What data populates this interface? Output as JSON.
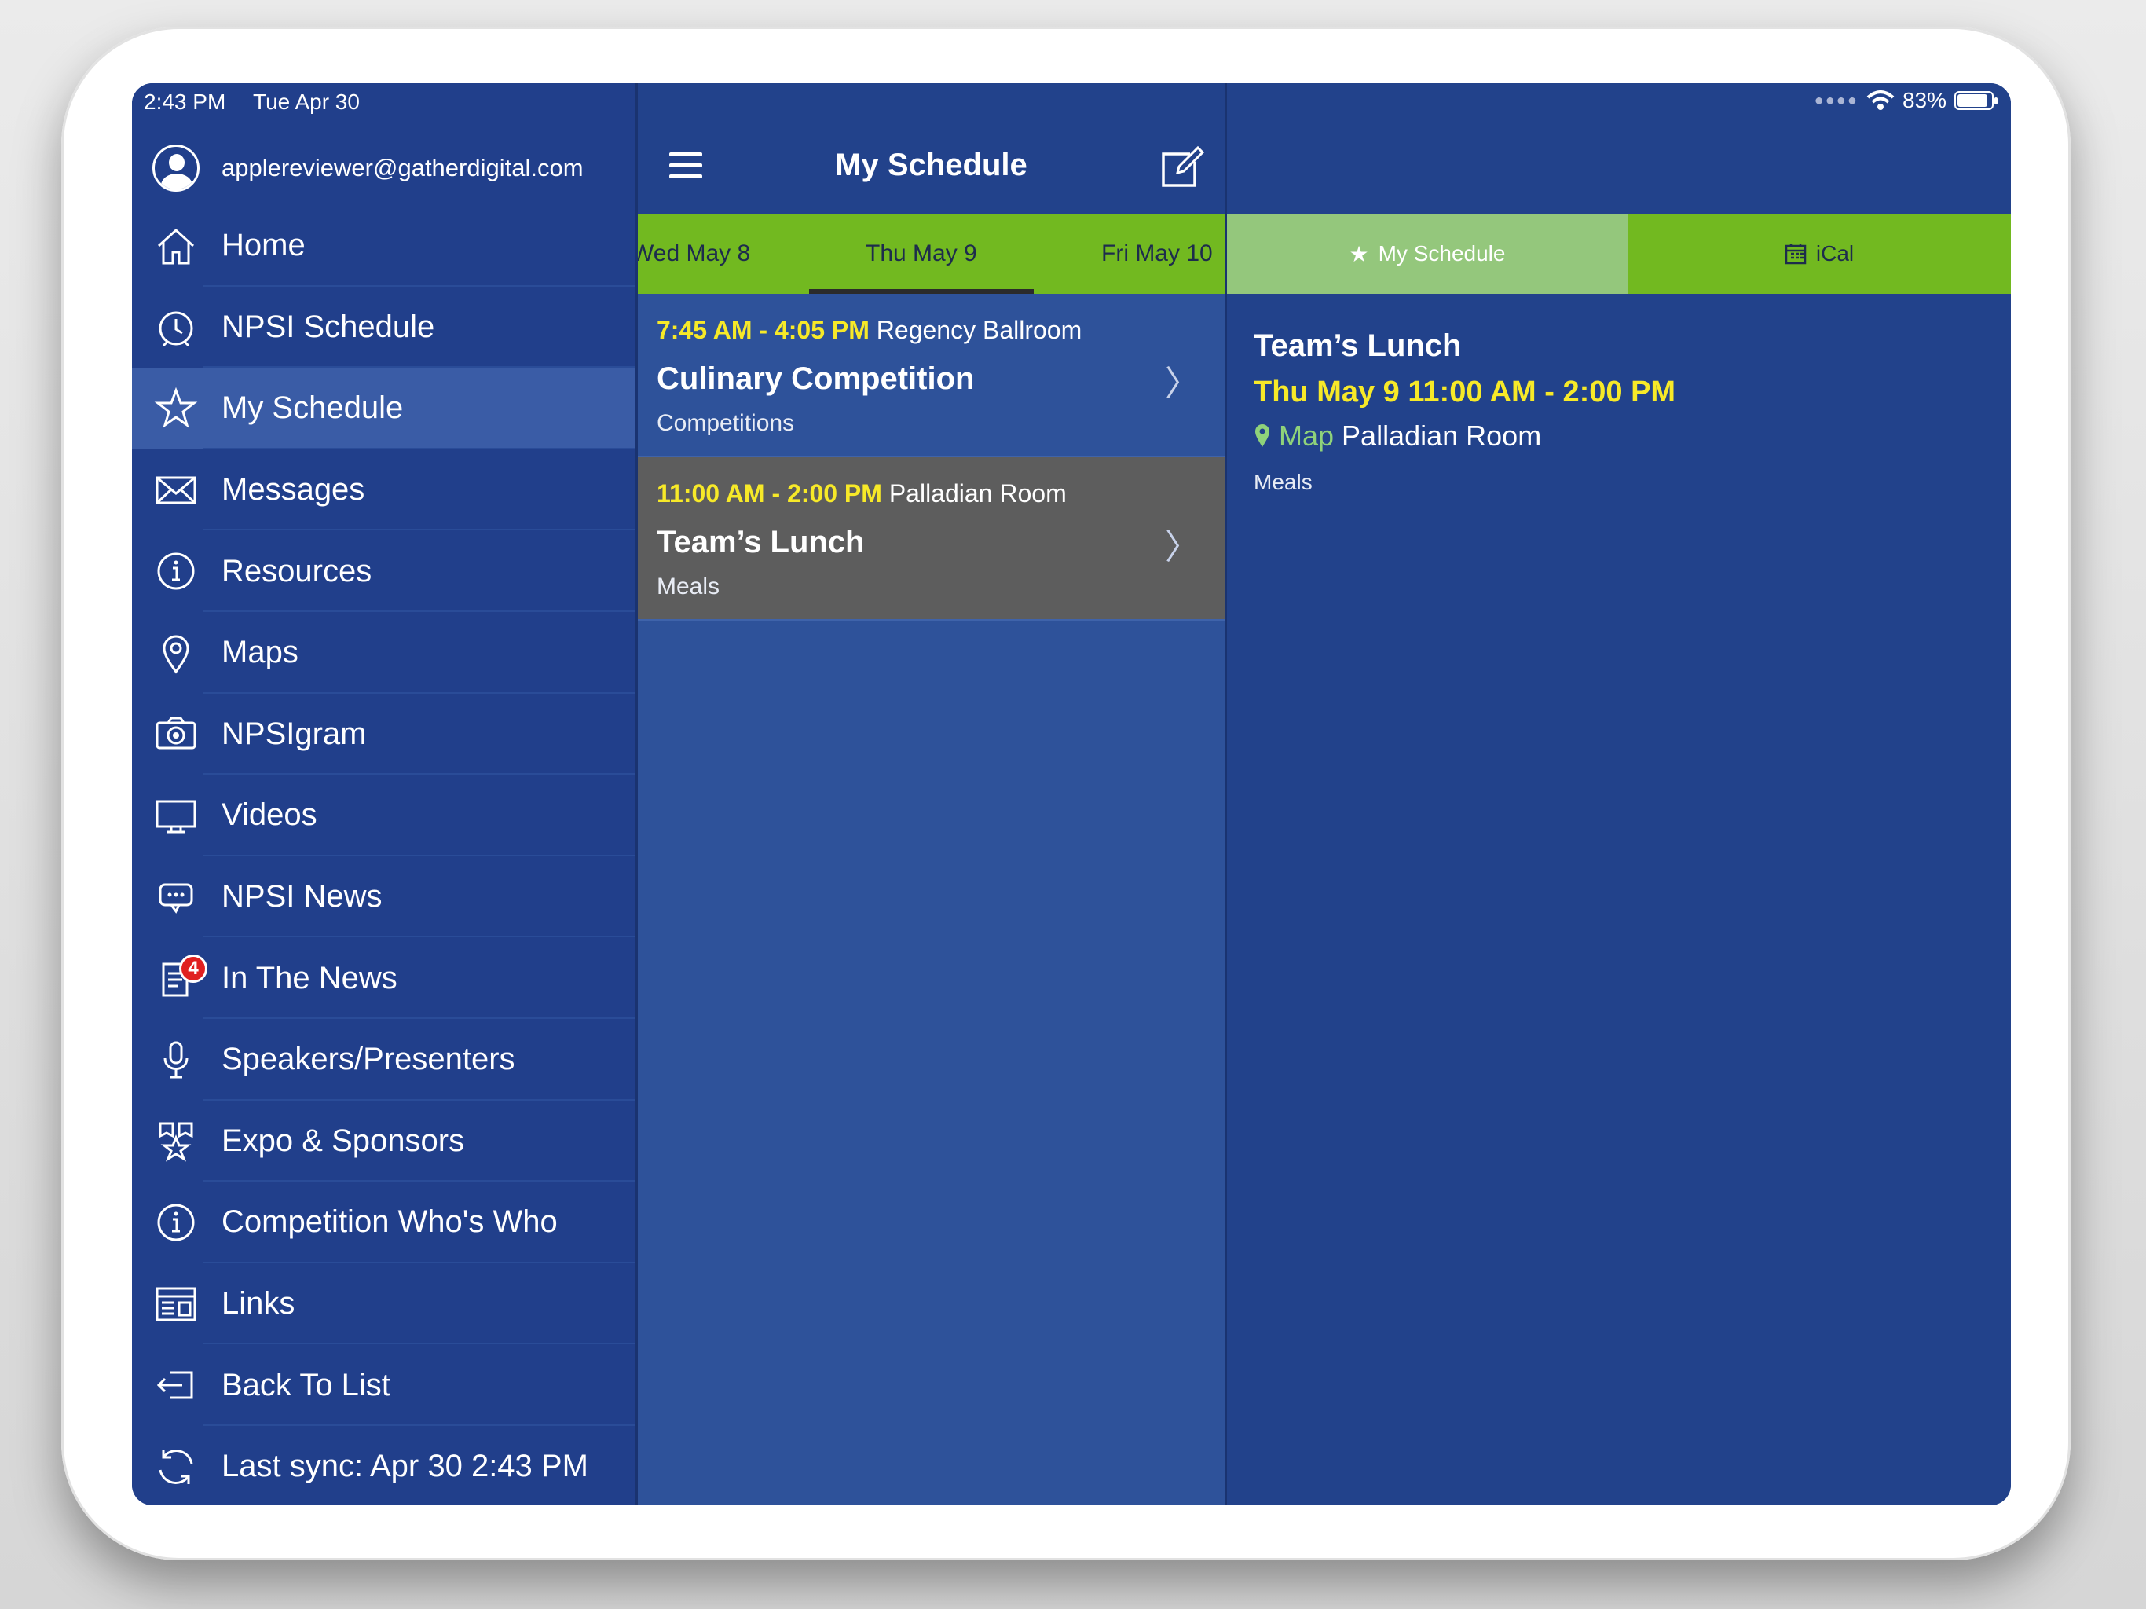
{
  "status_bar": {
    "time": "2:43 PM",
    "date": "Tue Apr 30",
    "battery": "83%"
  },
  "sidebar": {
    "account_email": "applereviewer@gatherdigital.com",
    "items": [
      {
        "label": "Home",
        "icon": "home-icon"
      },
      {
        "label": "NPSI Schedule",
        "icon": "clock-icon"
      },
      {
        "label": "My Schedule",
        "icon": "star-icon",
        "active": true
      },
      {
        "label": "Messages",
        "icon": "envelope-icon"
      },
      {
        "label": "Resources",
        "icon": "info-icon"
      },
      {
        "label": "Maps",
        "icon": "map-pin-icon"
      },
      {
        "label": "NPSIgram",
        "icon": "camera-icon"
      },
      {
        "label": "Videos",
        "icon": "monitor-icon"
      },
      {
        "label": "NPSI News",
        "icon": "chat-icon"
      },
      {
        "label": "In The News",
        "icon": "newspaper-icon",
        "badge": "4"
      },
      {
        "label": "Speakers/Presenters",
        "icon": "microphone-icon"
      },
      {
        "label": "Expo & Sponsors",
        "icon": "award-icon"
      },
      {
        "label": "Competition Who's Who",
        "icon": "info-icon"
      },
      {
        "label": "Links",
        "icon": "browser-icon"
      },
      {
        "label": "Back To List",
        "icon": "exit-icon"
      },
      {
        "label": "Last sync:  Apr 30 2:43 PM",
        "icon": "sync-icon"
      }
    ]
  },
  "middle": {
    "title": "My Schedule",
    "days": [
      {
        "label": "Wed  May 8"
      },
      {
        "label": "Thu  May 9",
        "selected": true
      },
      {
        "label": "Fri  May 10"
      }
    ],
    "events": [
      {
        "time": "7:45 AM - 4:05 PM",
        "room": "Regency Ballroom",
        "title": "Culinary Competition",
        "category": "Competitions"
      },
      {
        "time": "11:00 AM - 2:00 PM",
        "room": "Palladian Room",
        "title": "Team’s Lunch",
        "category": "Meals",
        "selected": true
      }
    ]
  },
  "detail": {
    "tabs": [
      {
        "label": "My Schedule",
        "icon": "star-icon"
      },
      {
        "label": "iCal",
        "icon": "calendar-icon"
      }
    ],
    "title": "Team’s Lunch",
    "when": "Thu  May 9 11:00 AM - 2:00 PM",
    "map_label": "Map",
    "room": "Palladian Room",
    "category": "Meals"
  },
  "colors": {
    "navy": "#22428b",
    "highlight": "#3a5ca6",
    "green": "#72b920",
    "yellow": "#f7e928",
    "selected_event": "#5d5d5d"
  }
}
